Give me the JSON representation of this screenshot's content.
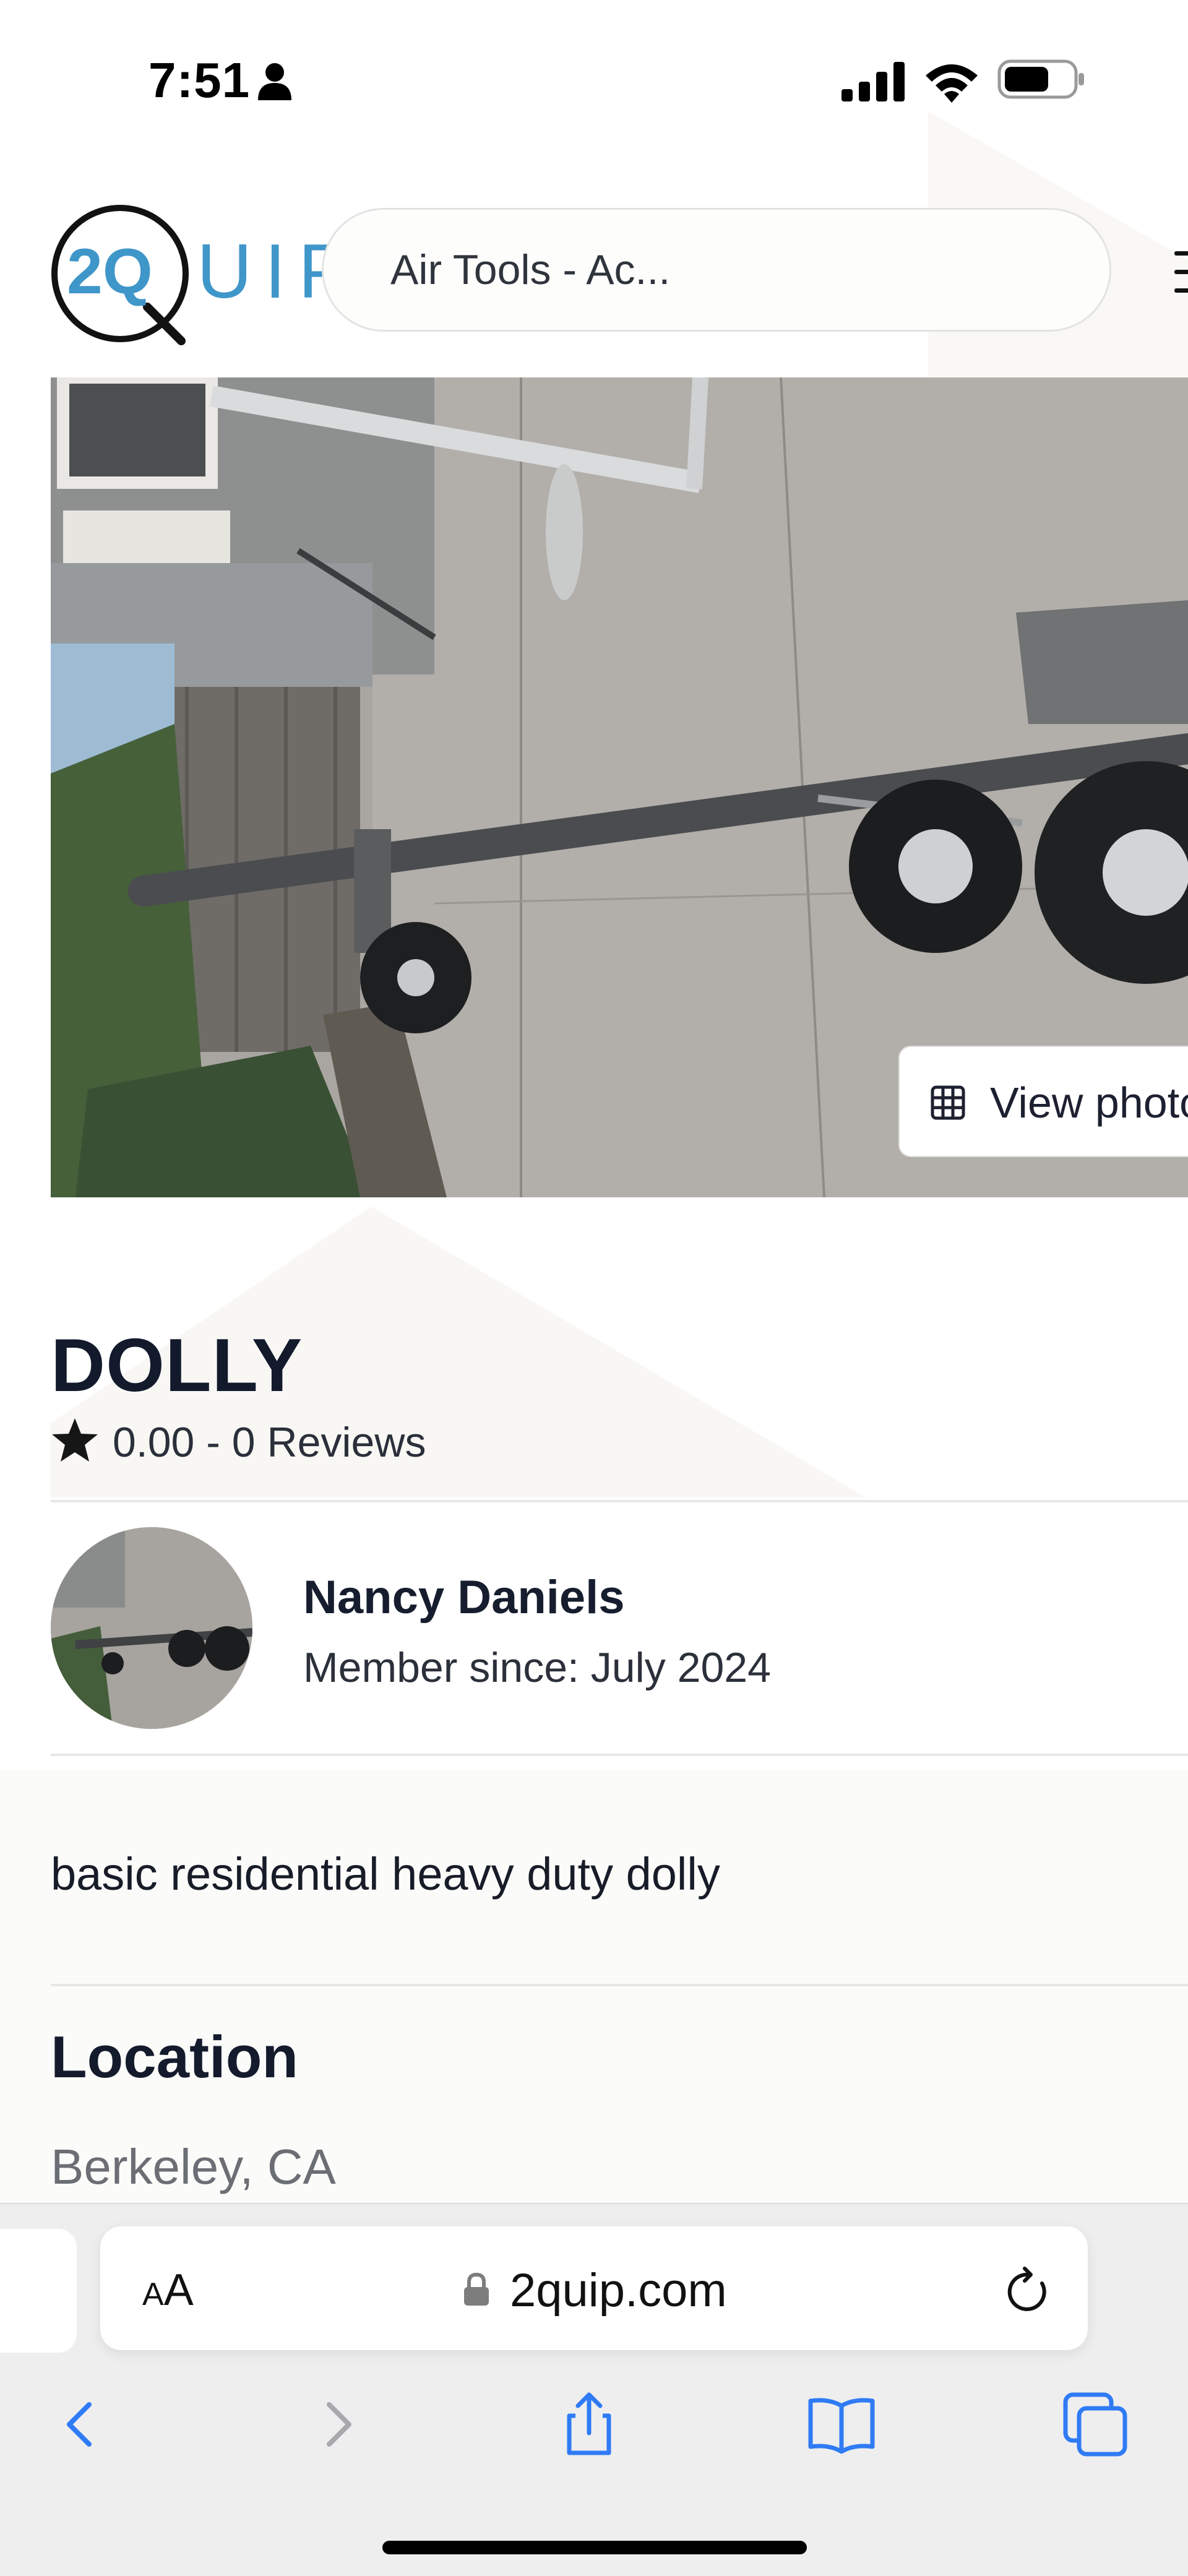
{
  "status_bar": {
    "time": "7:51",
    "icons": [
      "person-icon",
      "cellular-signal-icon",
      "wifi-icon",
      "battery-icon"
    ]
  },
  "header": {
    "logo_mark_text": "2Q",
    "logo_text": "UIP",
    "search_value": "Air Tools - Ac...",
    "menu_icon": "hamburger-menu-icon"
  },
  "hero": {
    "view_photos_label": "View photos",
    "view_photos_icon": "grid-icon"
  },
  "listing": {
    "title": "DOLLY",
    "rating_text": "0.00 - 0 Reviews",
    "rating_icon": "star-icon",
    "owner": {
      "name": "Nancy Daniels",
      "member_since": "Member since: July 2024"
    },
    "description": "basic residential heavy duty dolly",
    "location_heading": "Location",
    "location_value": "Berkeley, CA"
  },
  "browser": {
    "aa_label_small": "A",
    "aa_label_large": "A",
    "url": "2quip.com",
    "icons": [
      "lock-icon",
      "reload-icon",
      "back-icon",
      "forward-icon",
      "share-icon",
      "bookmarks-icon",
      "tabs-icon"
    ]
  },
  "colors": {
    "brand_blue": "#3f96c9",
    "browser_accent": "#2f7bf5",
    "text_dark": "#121a2c",
    "muted": "#6b6e74"
  }
}
